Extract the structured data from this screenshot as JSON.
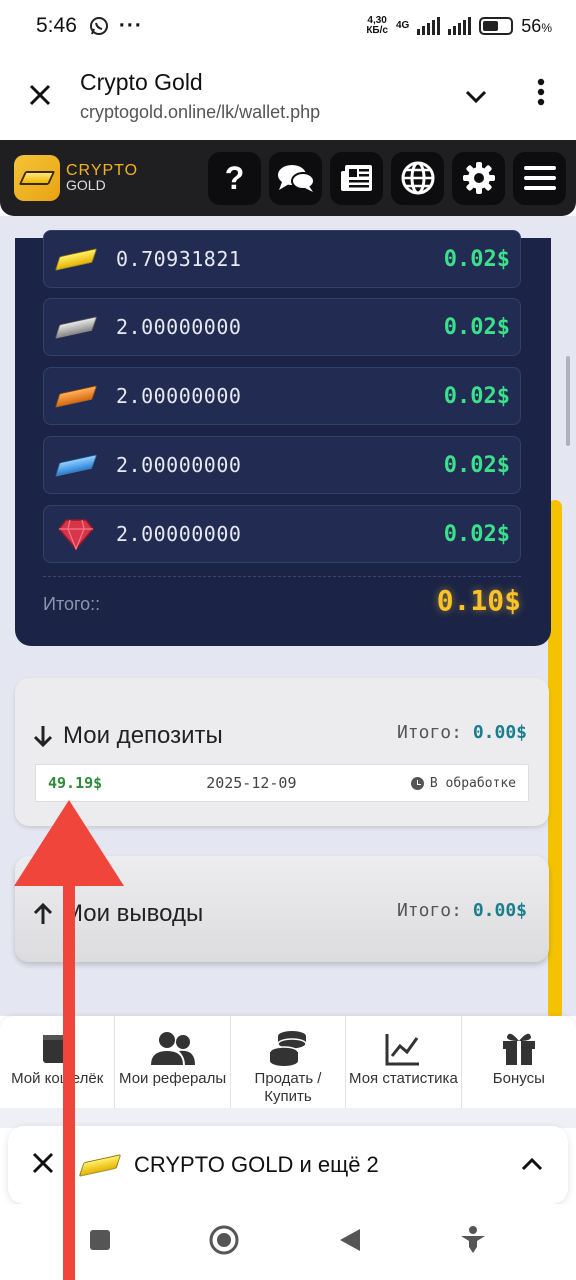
{
  "status": {
    "time": "5:46",
    "net_speed": "4,30",
    "net_unit": "КБ/с",
    "net_type": "4G",
    "battery": "56",
    "battery_suffix": "%"
  },
  "browser": {
    "title": "Crypto Gold",
    "url": "cryptogold.online/lk/wallet.php"
  },
  "header": {
    "logo_line1": "CRYPTO",
    "logo_line2": "GOLD",
    "buttons": [
      {
        "icon": "question-icon"
      },
      {
        "icon": "chat-icon"
      },
      {
        "icon": "news-icon"
      },
      {
        "icon": "globe-icon"
      },
      {
        "icon": "gear-icon"
      },
      {
        "icon": "menu-icon"
      }
    ]
  },
  "wallet": {
    "assets": [
      {
        "icon": "gold-ingot-icon",
        "color": "#f2c200",
        "amount": "0.70931821",
        "usd": "0.02$"
      },
      {
        "icon": "silver-ingot-icon",
        "color": "#a8a8a8",
        "amount": "2.00000000",
        "usd": "0.02$"
      },
      {
        "icon": "bronze-ingot-icon",
        "color": "#ef8a28",
        "amount": "2.00000000",
        "usd": "0.02$"
      },
      {
        "icon": "blue-ingot-icon",
        "color": "#3a9ae8",
        "amount": "2.00000000",
        "usd": "0.02$"
      },
      {
        "icon": "ruby-icon",
        "color": "#d8344a",
        "amount": "2.00000000",
        "usd": "0.02$"
      }
    ],
    "total_label": "Итого::",
    "total_value": "0.10$"
  },
  "deposits": {
    "title": "Мои депозиты",
    "total_label": "Итого:",
    "total_value": "0.00$",
    "rows": [
      {
        "amount": "49.19$",
        "date": "2025-12-09",
        "status": "В обработке"
      }
    ]
  },
  "withdrawals": {
    "title": "Мои выводы",
    "total_label": "Итого:",
    "total_value": "0.00$"
  },
  "bottom_nav": [
    {
      "icon": "wallet-icon",
      "label": "Мой кошелёк"
    },
    {
      "icon": "users-icon",
      "label": "Мои рефералы"
    },
    {
      "icon": "coins-icon",
      "label": "Продать / Купить"
    },
    {
      "icon": "chart-icon",
      "label": "Моя статистика"
    },
    {
      "icon": "gift-icon",
      "label": "Бонусы"
    }
  ],
  "notification": {
    "text": "CRYPTO GOLD и ещё 2"
  },
  "colors": {
    "accent_gold": "#f9c22a",
    "usd_green": "#3ce08b",
    "annotation_arrow": "#f0453a"
  }
}
